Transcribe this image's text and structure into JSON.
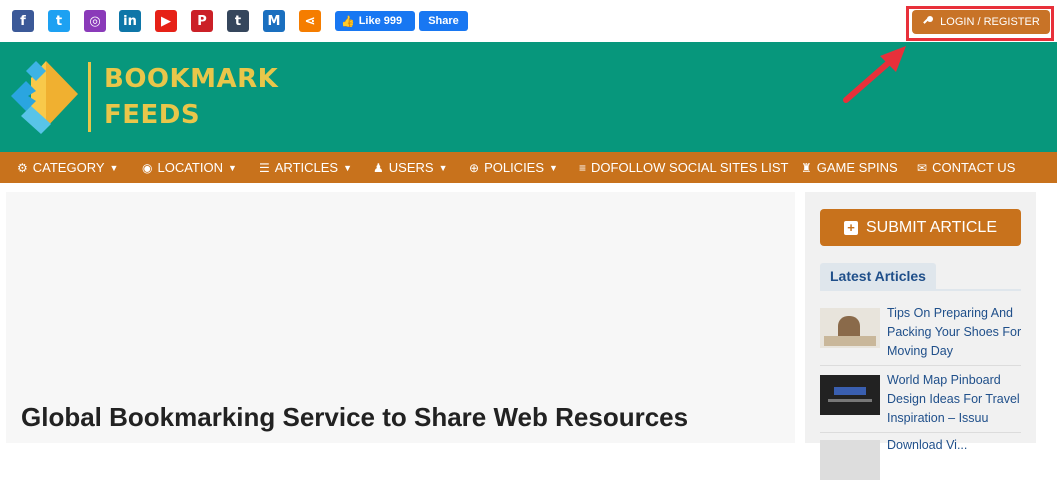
{
  "topbar": {
    "social_icons": [
      {
        "name": "facebook-icon",
        "glyph": "f",
        "color": "#3b5998"
      },
      {
        "name": "twitter-icon",
        "glyph": "t",
        "color": "#1da1f2"
      },
      {
        "name": "instagram-icon",
        "glyph": "◎",
        "color": "#8a3ab9"
      },
      {
        "name": "linkedin-icon",
        "glyph": "in",
        "color": "#0e76a8"
      },
      {
        "name": "youtube-icon",
        "glyph": "▶",
        "color": "#e62117"
      },
      {
        "name": "pinterest-icon",
        "glyph": "P",
        "color": "#cb2027"
      },
      {
        "name": "tumblr-icon",
        "glyph": "t",
        "color": "#35465c"
      },
      {
        "name": "medium-icon",
        "glyph": "M",
        "color": "#1a6fbf"
      },
      {
        "name": "share-icon",
        "glyph": "⋖",
        "color": "#f57d00"
      }
    ],
    "fb_like_label": "Like 999",
    "fb_share_label": "Share",
    "login_label": "LOGIN / REGISTER"
  },
  "header": {
    "logo_line1": "BOOKMARK",
    "logo_line2": "FEEDS",
    "accent_color": "#07977c"
  },
  "nav": {
    "items": [
      {
        "label": "CATEGORY",
        "icon": "⚙",
        "dropdown": true
      },
      {
        "label": "LOCATION",
        "icon": "◉",
        "dropdown": true
      },
      {
        "label": "ARTICLES",
        "icon": "☰",
        "dropdown": true
      },
      {
        "label": "USERS",
        "icon": "♟",
        "dropdown": true
      },
      {
        "label": "POLICIES",
        "icon": "⊕",
        "dropdown": true
      },
      {
        "label": "DOFOLLOW SOCIAL SITES LIST",
        "icon": "≡",
        "dropdown": false
      },
      {
        "label": "GAME SPINS",
        "icon": "♜",
        "dropdown": false
      },
      {
        "label": "CONTACT US",
        "icon": "✉",
        "dropdown": false
      }
    ],
    "color": "#c8721c"
  },
  "main": {
    "headline": "Global Bookmarking Service to Share Web Resources"
  },
  "sidebar": {
    "submit_label": "SUBMIT ARTICLE",
    "latest_label": "Latest Articles",
    "articles": [
      {
        "title": "Tips On Preparing And Packing Your Shoes For Moving Day"
      },
      {
        "title": "World Map Pinboard Design Ideas For Travel Inspiration – Issuu"
      },
      {
        "title": "Download Vi..."
      }
    ]
  }
}
